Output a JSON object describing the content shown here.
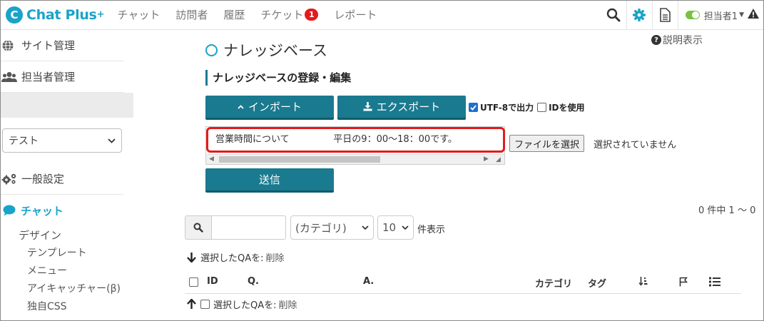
{
  "header": {
    "logo_mark": "C",
    "logo_text": "Chat Plus",
    "logo_plus": "+",
    "nav": [
      {
        "label": "チャット"
      },
      {
        "label": "訪問者"
      },
      {
        "label": "履歴"
      },
      {
        "label": "チケット",
        "badge": "1"
      },
      {
        "label": "レポート"
      }
    ],
    "user_label": "担当者1"
  },
  "sidebar": {
    "top_items": [
      {
        "label": "サイト管理",
        "icon": "globe-icon"
      },
      {
        "label": "担当者管理",
        "icon": "users-icon"
      }
    ],
    "site_select": "テスト",
    "general_settings": "一般設定",
    "chat_label": "チャット",
    "chat_sub": "デザイン",
    "chat_children": [
      "テンプレート",
      "メニュー",
      "アイキャッチャー(β)",
      "独自CSS"
    ]
  },
  "main": {
    "help_label": "説明表示",
    "title": "ナレッジベース",
    "section_title": "ナレッジベースの登録・編集",
    "import_label": "インポート",
    "export_label": "エクスポート",
    "utf8_label": "UTF-8で出力",
    "id_label": "IDを使用",
    "textarea_text": "営業時間について\t\t平日の9：00〜18：00です。",
    "file_button": "ファイルを選択",
    "file_status": "選択されていません",
    "send_label": "送信",
    "count_text": "0 件中 1 ～ 0",
    "category_select": "(カテゴリ)",
    "per_page_select": "10",
    "per_page_label": "件表示",
    "bulk_label": "選択したQAを:",
    "delete_label": "削除",
    "columns": {
      "id": "ID",
      "q": "Q.",
      "a": "A.",
      "category": "カテゴリ",
      "tag": "タグ"
    }
  },
  "colors": {
    "brand": "#1aa3c8",
    "button": "#1a7a8f",
    "highlight": "#e31b1b",
    "badge": "#e31b1b",
    "toggle": "#7ac143"
  }
}
